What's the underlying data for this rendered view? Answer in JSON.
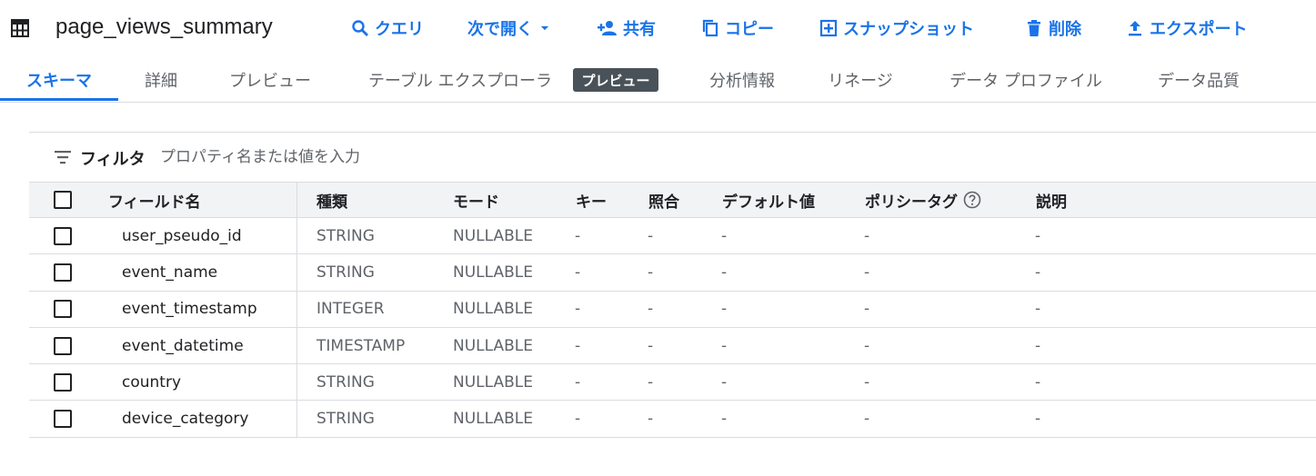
{
  "header": {
    "title": "page_views_summary",
    "actions": [
      {
        "label": "クエリ",
        "icon": "search-icon"
      },
      {
        "label": "次で開く",
        "icon": "chevron-down-icon"
      },
      {
        "label": "共有",
        "icon": "person-add-icon"
      },
      {
        "label": "コピー",
        "icon": "copy-icon"
      },
      {
        "label": "スナップショット",
        "icon": "snapshot-icon"
      },
      {
        "label": "削除",
        "icon": "trash-icon"
      },
      {
        "label": "エクスポート",
        "icon": "upload-icon"
      }
    ]
  },
  "tabs": [
    {
      "label": "スキーマ",
      "active": true
    },
    {
      "label": "詳細"
    },
    {
      "label": "プレビュー"
    },
    {
      "label": "テーブル エクスプローラ"
    },
    {
      "label": "分析情報"
    },
    {
      "label": "リネージ"
    },
    {
      "label": "データ プロファイル"
    },
    {
      "label": "データ品質"
    }
  ],
  "preview_badge": "プレビュー",
  "filter": {
    "label": "フィルタ",
    "placeholder": "プロパティ名または値を入力"
  },
  "table": {
    "columns": [
      "フィールド名",
      "種類",
      "モード",
      "キー",
      "照合",
      "デフォルト値",
      "ポリシータグ",
      "説明"
    ],
    "rows": [
      {
        "name": "user_pseudo_id",
        "type": "STRING",
        "mode": "NULLABLE",
        "key": "-",
        "collation": "-",
        "default": "-",
        "policy": "-",
        "desc": "-"
      },
      {
        "name": "event_name",
        "type": "STRING",
        "mode": "NULLABLE",
        "key": "-",
        "collation": "-",
        "default": "-",
        "policy": "-",
        "desc": "-"
      },
      {
        "name": "event_timestamp",
        "type": "INTEGER",
        "mode": "NULLABLE",
        "key": "-",
        "collation": "-",
        "default": "-",
        "policy": "-",
        "desc": "-"
      },
      {
        "name": "event_datetime",
        "type": "TIMESTAMP",
        "mode": "NULLABLE",
        "key": "-",
        "collation": "-",
        "default": "-",
        "policy": "-",
        "desc": "-"
      },
      {
        "name": "country",
        "type": "STRING",
        "mode": "NULLABLE",
        "key": "-",
        "collation": "-",
        "default": "-",
        "policy": "-",
        "desc": "-"
      },
      {
        "name": "device_category",
        "type": "STRING",
        "mode": "NULLABLE",
        "key": "-",
        "collation": "-",
        "default": "-",
        "policy": "-",
        "desc": "-"
      }
    ]
  },
  "colors": {
    "accent": "#1a73e8",
    "badge": "#4a5259"
  }
}
